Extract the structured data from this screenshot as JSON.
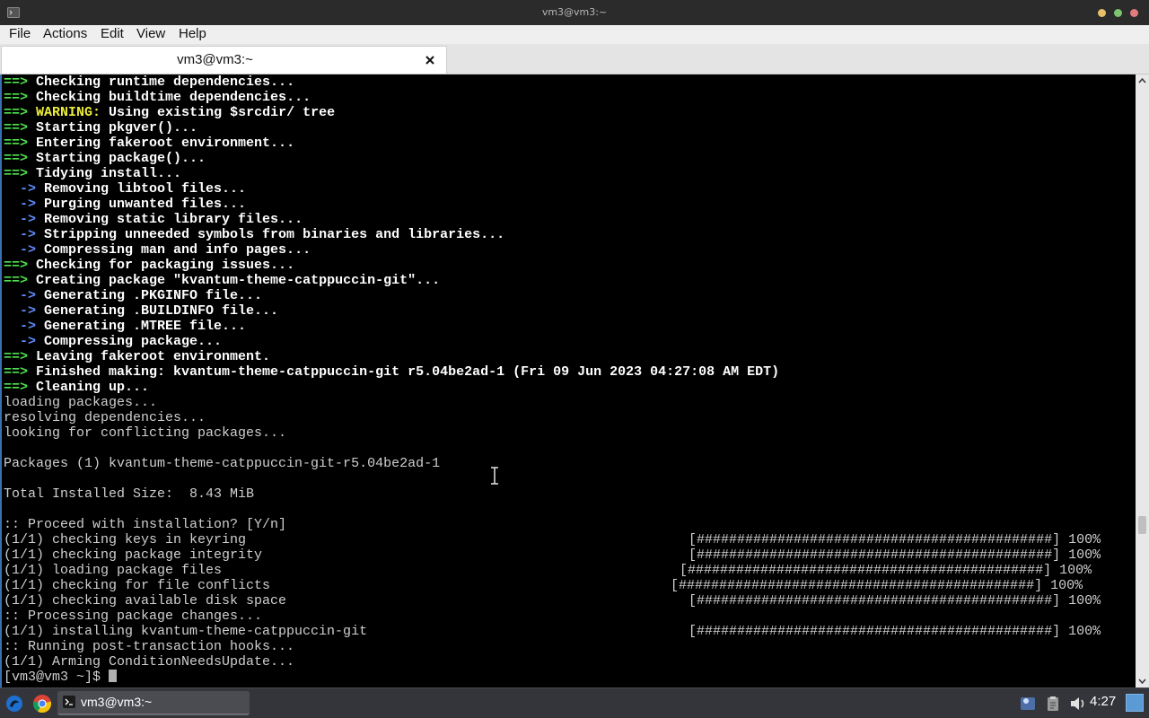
{
  "window": {
    "title": "vm3@vm3:~",
    "buttons": {
      "minimize_color": "#e8c06a",
      "maximize_color": "#7dc370",
      "close_color": "#e27d7d"
    }
  },
  "menubar": {
    "items": [
      "File",
      "Actions",
      "Edit",
      "View",
      "Help"
    ]
  },
  "tab": {
    "label": "vm3@vm3:~",
    "close_icon": "close-icon"
  },
  "colors": {
    "arrow_green": "#4fe14f",
    "arrow_blue": "#5f8cff",
    "warning_yellow": "#ecec3c",
    "text_gray": "#cfcfcf",
    "text_bold": "#ffffff"
  },
  "terminal": {
    "lines": [
      {
        "type": "green",
        "marker": "==>",
        "text": " Checking runtime dependencies..."
      },
      {
        "type": "green",
        "marker": "==>",
        "text": " Checking buildtime dependencies..."
      },
      {
        "type": "warning",
        "marker": "==>",
        "keyword": "WARNING:",
        "text": " Using existing $srcdir/ tree"
      },
      {
        "type": "green",
        "marker": "==>",
        "text": " Starting pkgver()..."
      },
      {
        "type": "green",
        "marker": "==>",
        "text": " Entering fakeroot environment..."
      },
      {
        "type": "green",
        "marker": "==>",
        "text": " Starting package()..."
      },
      {
        "type": "green",
        "marker": "==>",
        "text": " Tidying install..."
      },
      {
        "type": "blue",
        "marker": "  ->",
        "text": " Removing libtool files..."
      },
      {
        "type": "blue",
        "marker": "  ->",
        "text": " Purging unwanted files..."
      },
      {
        "type": "blue",
        "marker": "  ->",
        "text": " Removing static library files..."
      },
      {
        "type": "blue",
        "marker": "  ->",
        "text": " Stripping unneeded symbols from binaries and libraries..."
      },
      {
        "type": "blue",
        "marker": "  ->",
        "text": " Compressing man and info pages..."
      },
      {
        "type": "green",
        "marker": "==>",
        "text": " Checking for packaging issues..."
      },
      {
        "type": "green",
        "marker": "==>",
        "text": " Creating package \"kvantum-theme-catppuccin-git\"..."
      },
      {
        "type": "blue",
        "marker": "  ->",
        "text": " Generating .PKGINFO file..."
      },
      {
        "type": "blue",
        "marker": "  ->",
        "text": " Generating .BUILDINFO file..."
      },
      {
        "type": "blue",
        "marker": "  ->",
        "text": " Generating .MTREE file..."
      },
      {
        "type": "blue",
        "marker": "  ->",
        "text": " Compressing package..."
      },
      {
        "type": "green",
        "marker": "==>",
        "text": " Leaving fakeroot environment."
      },
      {
        "type": "green",
        "marker": "==>",
        "text": " Finished making: kvantum-theme-catppuccin-git r5.04be2ad-1 (Fri 09 Jun 2023 04:27:08 AM EDT)"
      },
      {
        "type": "green",
        "marker": "==>",
        "text": " Cleaning up..."
      },
      {
        "type": "plain",
        "text": "loading packages..."
      },
      {
        "type": "plain",
        "text": "resolving dependencies..."
      },
      {
        "type": "plain",
        "text": "looking for conflicting packages..."
      },
      {
        "type": "plain",
        "text": ""
      },
      {
        "type": "plain",
        "text": "Packages (1) kvantum-theme-catppuccin-git-r5.04be2ad-1"
      },
      {
        "type": "plain",
        "text": ""
      },
      {
        "type": "plain",
        "text": "Total Installed Size:  8.43 MiB"
      },
      {
        "type": "plain",
        "text": ""
      },
      {
        "type": "plain",
        "text": ":: Proceed with installation? [Y/n]"
      },
      {
        "type": "progress",
        "text": "(1/1) checking keys in keyring",
        "bar": "[############################################] 100%"
      },
      {
        "type": "progress",
        "text": "(1/1) checking package integrity",
        "bar": "[############################################] 100%"
      },
      {
        "type": "progress",
        "text": "(1/1) loading package files",
        "bar": "[############################################] 100%"
      },
      {
        "type": "progress",
        "text": "(1/1) checking for file conflicts",
        "bar": "[############################################] 100%"
      },
      {
        "type": "progress",
        "text": "(1/1) checking available disk space",
        "bar": "[############################################] 100%"
      },
      {
        "type": "plain",
        "text": ":: Processing package changes..."
      },
      {
        "type": "progress",
        "text": "(1/1) installing kvantum-theme-catppuccin-git",
        "bar": "[############################################] 100%"
      },
      {
        "type": "plain",
        "text": ":: Running post-transaction hooks..."
      },
      {
        "type": "plain",
        "text": "(1/1) Arming ConditionNeedsUpdate..."
      },
      {
        "type": "prompt",
        "text": "[vm3@vm3 ~]$ "
      }
    ]
  },
  "taskbar": {
    "start_icon": "app-launcher-icon",
    "browser_icon": "chrome-icon",
    "task_label": "vm3@vm3:~",
    "task_icon": "terminal-icon",
    "tray_icons": [
      "notification-icon",
      "clipboard-icon",
      "volume-icon"
    ],
    "clock": "4:27",
    "show_desktop_icon": "show-desktop-icon"
  }
}
